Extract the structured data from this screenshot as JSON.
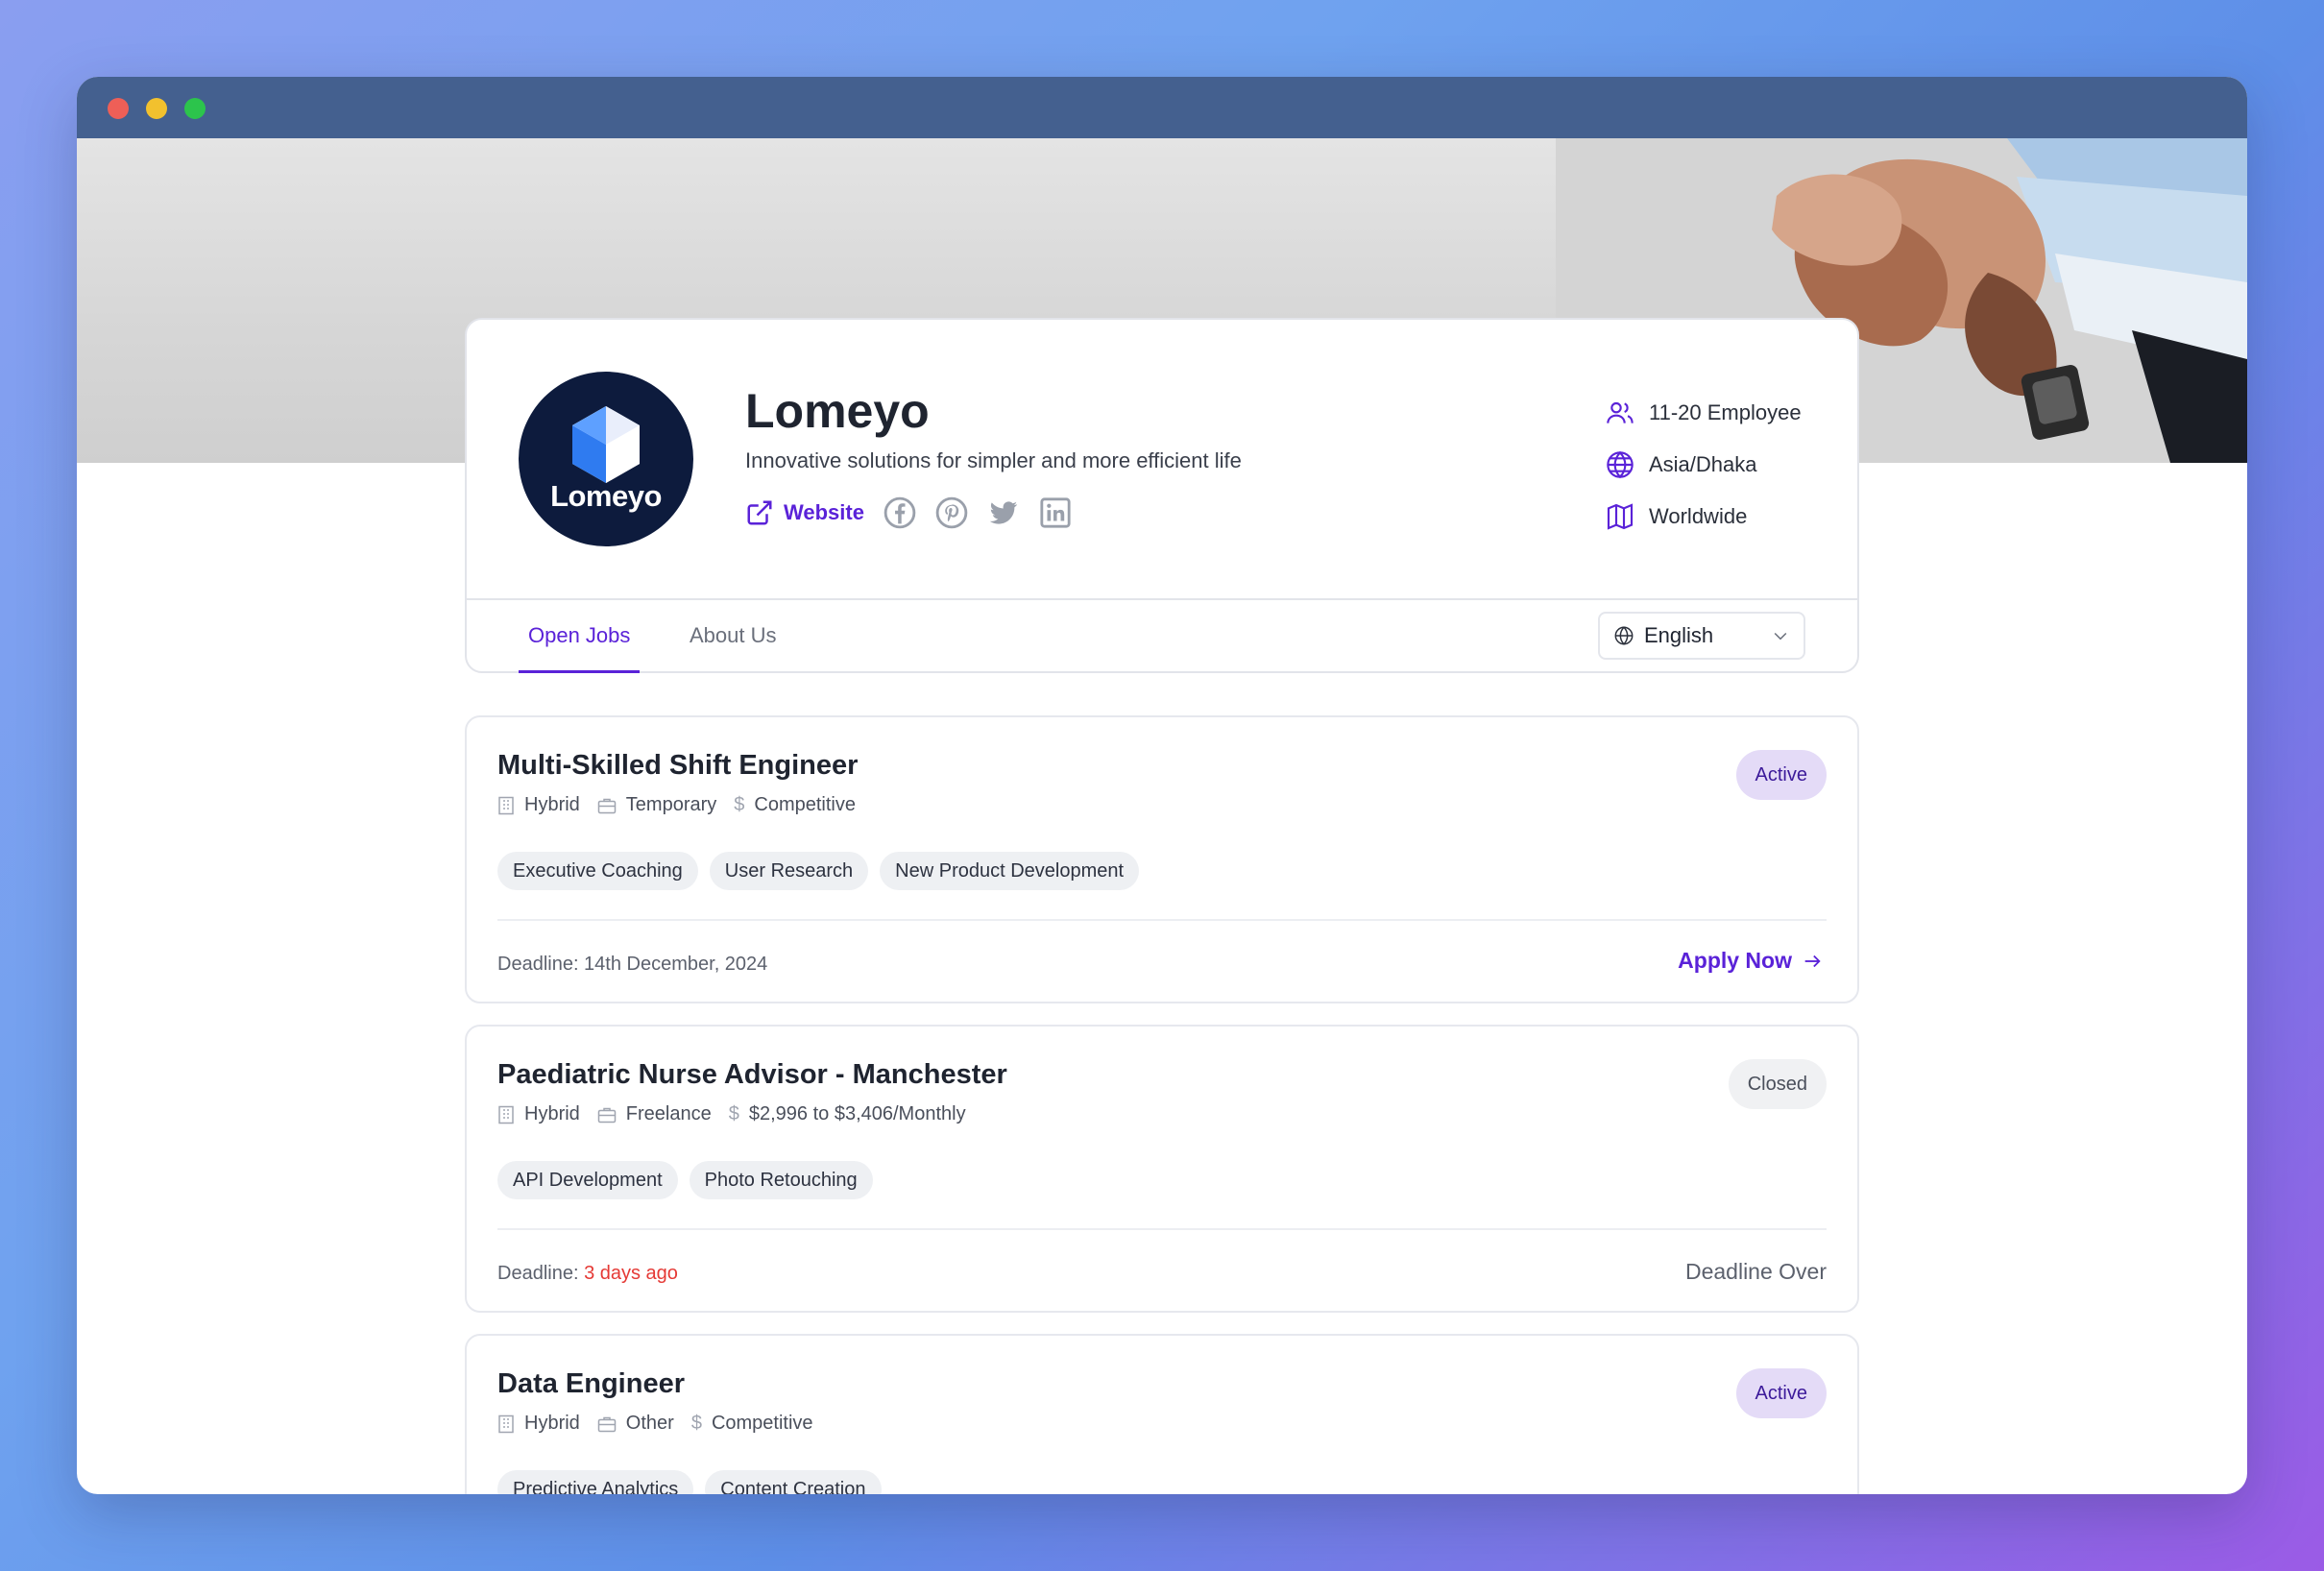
{
  "company": {
    "name": "Lomeyo",
    "logo_text": "Lomeyo",
    "tagline": "Innovative solutions for simpler and more efficient life",
    "website_label": "Website",
    "socials": [
      "facebook-icon",
      "pinterest-icon",
      "twitter-icon",
      "linkedin-icon"
    ],
    "meta": {
      "employees": "11-20 Employee",
      "timezone": "Asia/Dhaka",
      "region": "Worldwide"
    }
  },
  "tabs": {
    "open_jobs": "Open Jobs",
    "about_us": "About Us"
  },
  "language": {
    "selected": "English"
  },
  "jobs": [
    {
      "title": "Multi-Skilled Shift Engineer",
      "location": "Hybrid",
      "type": "Temporary",
      "salary": "Competitive",
      "tags": [
        "Executive Coaching",
        "User Research",
        "New Product Development"
      ],
      "deadline_label": "Deadline: 14th December, 2024",
      "status": "Active",
      "action": "Apply Now"
    },
    {
      "title": "Paediatric Nurse Advisor - Manchester",
      "location": "Hybrid",
      "type": "Freelance",
      "salary": "$2,996 to $3,406/Monthly",
      "tags": [
        "API Development",
        "Photo Retouching"
      ],
      "deadline_prefix": "Deadline: ",
      "deadline_value": "3 days ago",
      "status": "Closed",
      "action": "Deadline Over"
    },
    {
      "title": "Data Engineer",
      "location": "Hybrid",
      "type": "Other",
      "salary": "Competitive",
      "tags": [
        "Predictive Analytics",
        "Content Creation"
      ],
      "status": "Active"
    }
  ],
  "colors": {
    "accent": "#5a22d8",
    "titlebar": "#44608f",
    "logo_bg": "#0d1b3d",
    "late": "#e53935"
  }
}
